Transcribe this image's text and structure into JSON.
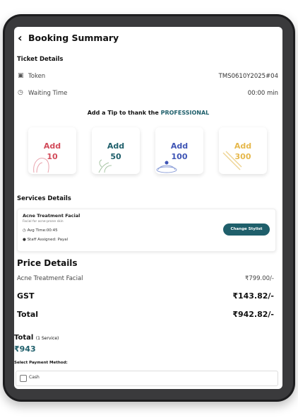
{
  "header": {
    "title": "Booking Summary",
    "back_icon": "chevron-left-icon"
  },
  "ticket": {
    "section_title": "Ticket Details",
    "token_label": "Token",
    "token_value": "TMS0610Y2025#04",
    "waiting_label": "Waiting Time",
    "waiting_value": "00:00 min"
  },
  "tip": {
    "prompt": "Add a Tip to thank the",
    "highlight": "PROFESSIONAL",
    "options": [
      {
        "label": "Add",
        "amount": "10",
        "color": "#d24b5a"
      },
      {
        "label": "Add",
        "amount": "50",
        "color": "#1f5f6b"
      },
      {
        "label": "Add",
        "amount": "100",
        "color": "#3f55b5"
      },
      {
        "label": "Add",
        "amount": "300",
        "color": "#e6b84c"
      }
    ]
  },
  "services": {
    "section_title": "Services Details",
    "name": "Acne Treatment Facial",
    "subtitle": "Facial for acne-prone skin",
    "avg_time_label": "Avg Time:",
    "avg_time_value": "00:45",
    "staff_label": "Staff Assigned:",
    "staff_value": "Payal",
    "change_button": "Change Stylist"
  },
  "price": {
    "section_title": "Price Details",
    "service_label": "Acne Treatment Facial",
    "service_value": "₹799.00/-",
    "gst_label": "GST",
    "gst_value": "₹143.82/-",
    "total_label": "Total",
    "total_value": "₹942.82/-"
  },
  "summary": {
    "total_label": "Total",
    "total_count": "(1 Service)",
    "total_amount": "₹943",
    "payment_label": "Select Payment Method:",
    "payment_option": "Cash"
  },
  "colors": {
    "accent": "#1f5f6b"
  }
}
